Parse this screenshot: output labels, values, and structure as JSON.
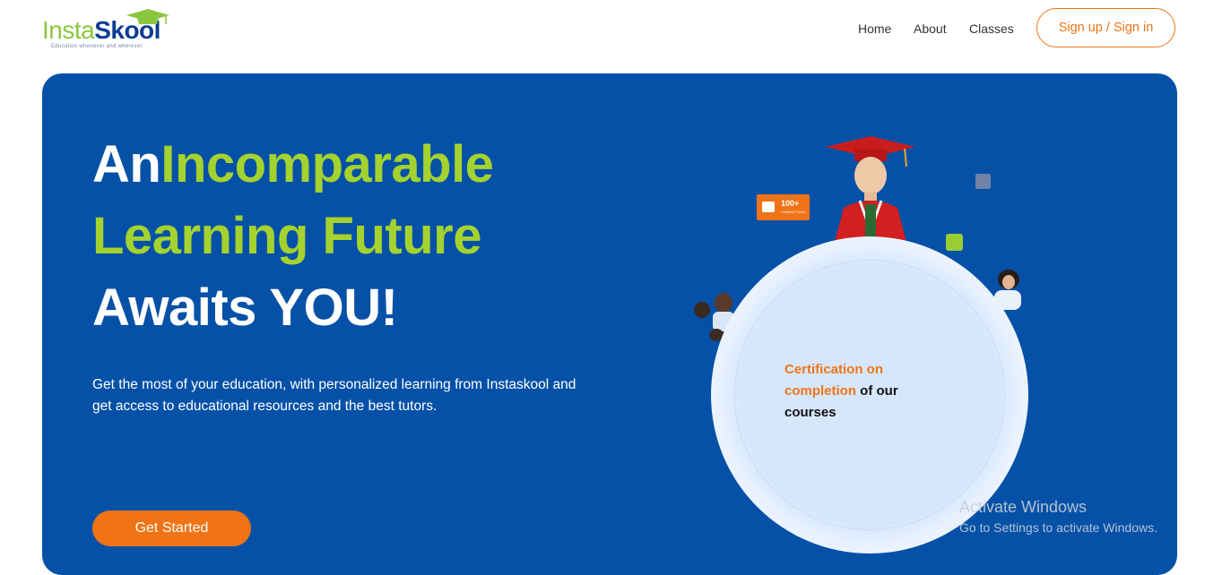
{
  "brand": {
    "part1": "Insta",
    "part2": "Skool",
    "tagline": "Education whenever and wherever"
  },
  "nav": {
    "links": [
      "Home",
      "About",
      "Classes"
    ],
    "sign_button": "Sign up / Sign in"
  },
  "hero": {
    "heading_line1_white": "An",
    "heading_line1_lime": "Incomparable",
    "heading_line2": "Learning Future",
    "heading_line3": "Awaits YOU!",
    "description": "Get the most of your education, with personalized learning from Instaskool and get access to educational resources and the best tutors.",
    "cta": "Get Started"
  },
  "illustration": {
    "badge_number": "100+",
    "badge_caption": "Certified Tutors",
    "cert_orange": "Certification on completion",
    "cert_black": " of our courses"
  },
  "watermark": {
    "title": "Activate Windows",
    "subtitle": "Go to Settings to activate Windows."
  },
  "colors": {
    "primary_blue": "#0551a7",
    "accent_orange": "#f07416",
    "accent_lime": "#a4d22e",
    "logo_navy": "#0b3d91"
  }
}
